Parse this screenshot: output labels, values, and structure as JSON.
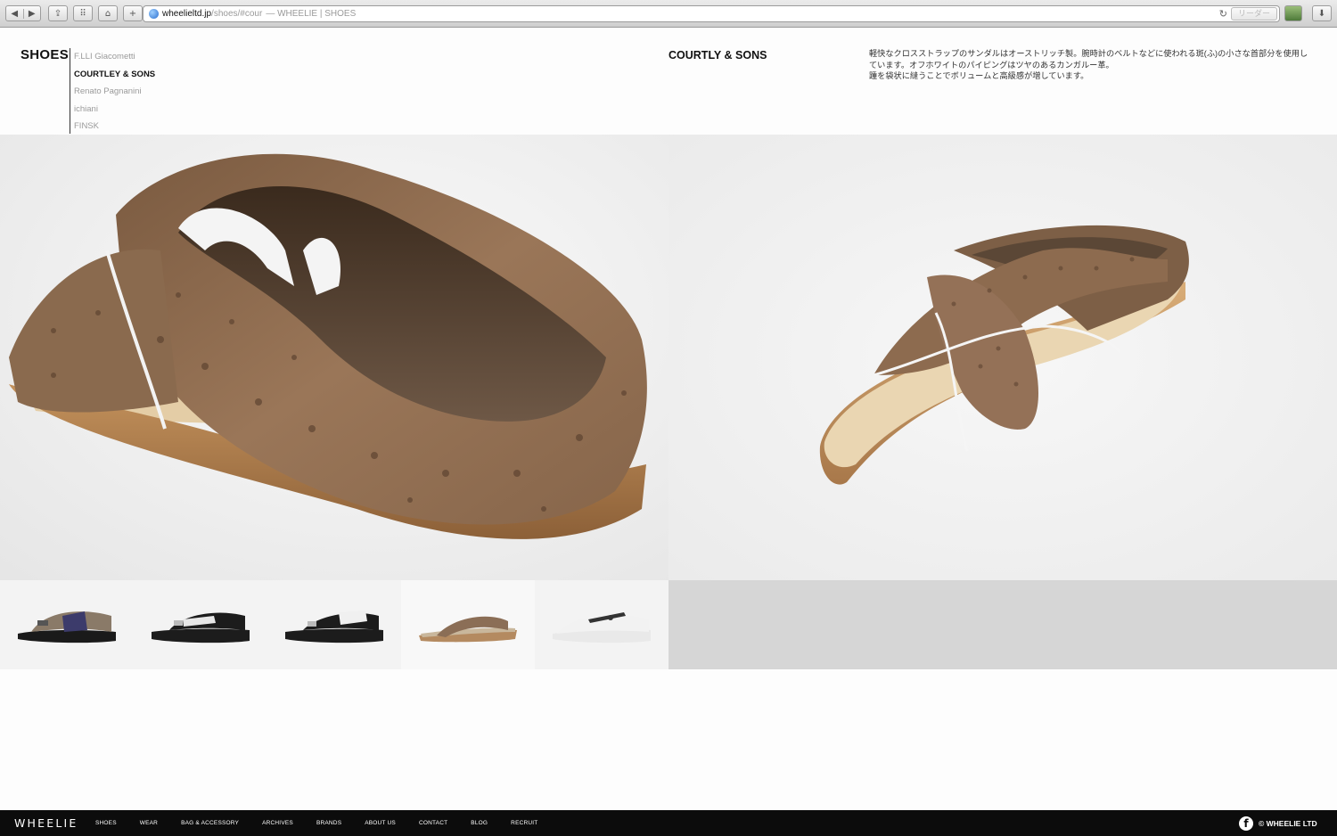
{
  "browser": {
    "url_host": "wheelieltd.jp",
    "url_rest": "/shoes/#cour",
    "page_title": "— WHEELIE | SHOES",
    "reader_label": "リーダー",
    "back_glyph": "◀",
    "forward_glyph": "▶",
    "share_glyph": "⇪",
    "topsites_glyph": "⠿",
    "home_glyph": "⌂",
    "add_glyph": "+",
    "reload_glyph": "↻",
    "download_glyph": "⬇"
  },
  "sidebar": {
    "title": "SHOES",
    "brands": [
      {
        "label": "F.LLI Giacometti",
        "active": false
      },
      {
        "label": "COURTLEY & SONS",
        "active": true
      },
      {
        "label": "Renato Pagnanini",
        "active": false
      },
      {
        "label": "ichiani",
        "active": false
      },
      {
        "label": "FINSK",
        "active": false
      }
    ]
  },
  "product": {
    "brand": "COURTLY & SONS",
    "description": [
      "軽快なクロスストラップのサンダルはオーストリッチ製。腕時計のベルトなどに使われる斑(ふ)の小さな首部分を使用し",
      "ています。オフホワイトのパイピングはツヤのあるカンガルー革。",
      "踵を袋状に縫うことでボリュームと高級感が増しています。"
    ],
    "images": [
      {
        "name": "main-photo-back-view",
        "subject": "ostrich cross-strap sandal, heel view"
      },
      {
        "name": "main-photo-side-view",
        "subject": "ostrich cross-strap sandal, side view"
      }
    ]
  },
  "thumbnails": [
    {
      "subject": "brown/navy strap sandal",
      "colors": [
        "#8a7a68",
        "#3c3b6b",
        "#1a1a1a"
      ],
      "selected": false
    },
    {
      "subject": "black/white strap sandal",
      "colors": [
        "#1c1c1c",
        "#e8e8e8",
        "#1c1c1c"
      ],
      "selected": false
    },
    {
      "subject": "black/white strap sandal",
      "colors": [
        "#1c1c1c",
        "#f0f0f0",
        "#1c1c1c"
      ],
      "selected": false
    },
    {
      "subject": "ostrich cross-strap sandal",
      "colors": [
        "#8b6e56",
        "#c9b79c",
        "#8b6e56"
      ],
      "selected": true
    },
    {
      "subject": "white t-bar shoe",
      "colors": [
        "#f2f2f2",
        "#333333",
        "#e9e9e9"
      ],
      "selected": false
    }
  ],
  "footer": {
    "logo": "WHEELIE",
    "nav": [
      "SHOES",
      "WEAR",
      "BAG & ACCESSORY",
      "ARCHIVES",
      "BRANDS",
      "ABOUT US",
      "CONTACT",
      "BLOG",
      "RECRUIT"
    ],
    "facebook_glyph": "f",
    "copyright": "© WHEELIE LTD"
  },
  "colors": {
    "page_bg": "#fdfdfd",
    "footer_bg": "#0c0c0c",
    "leather": "#8b6a4e",
    "sole": "#b98a5a",
    "footbed": "#e8d3b0",
    "gray_block": "#d6d6d6"
  }
}
